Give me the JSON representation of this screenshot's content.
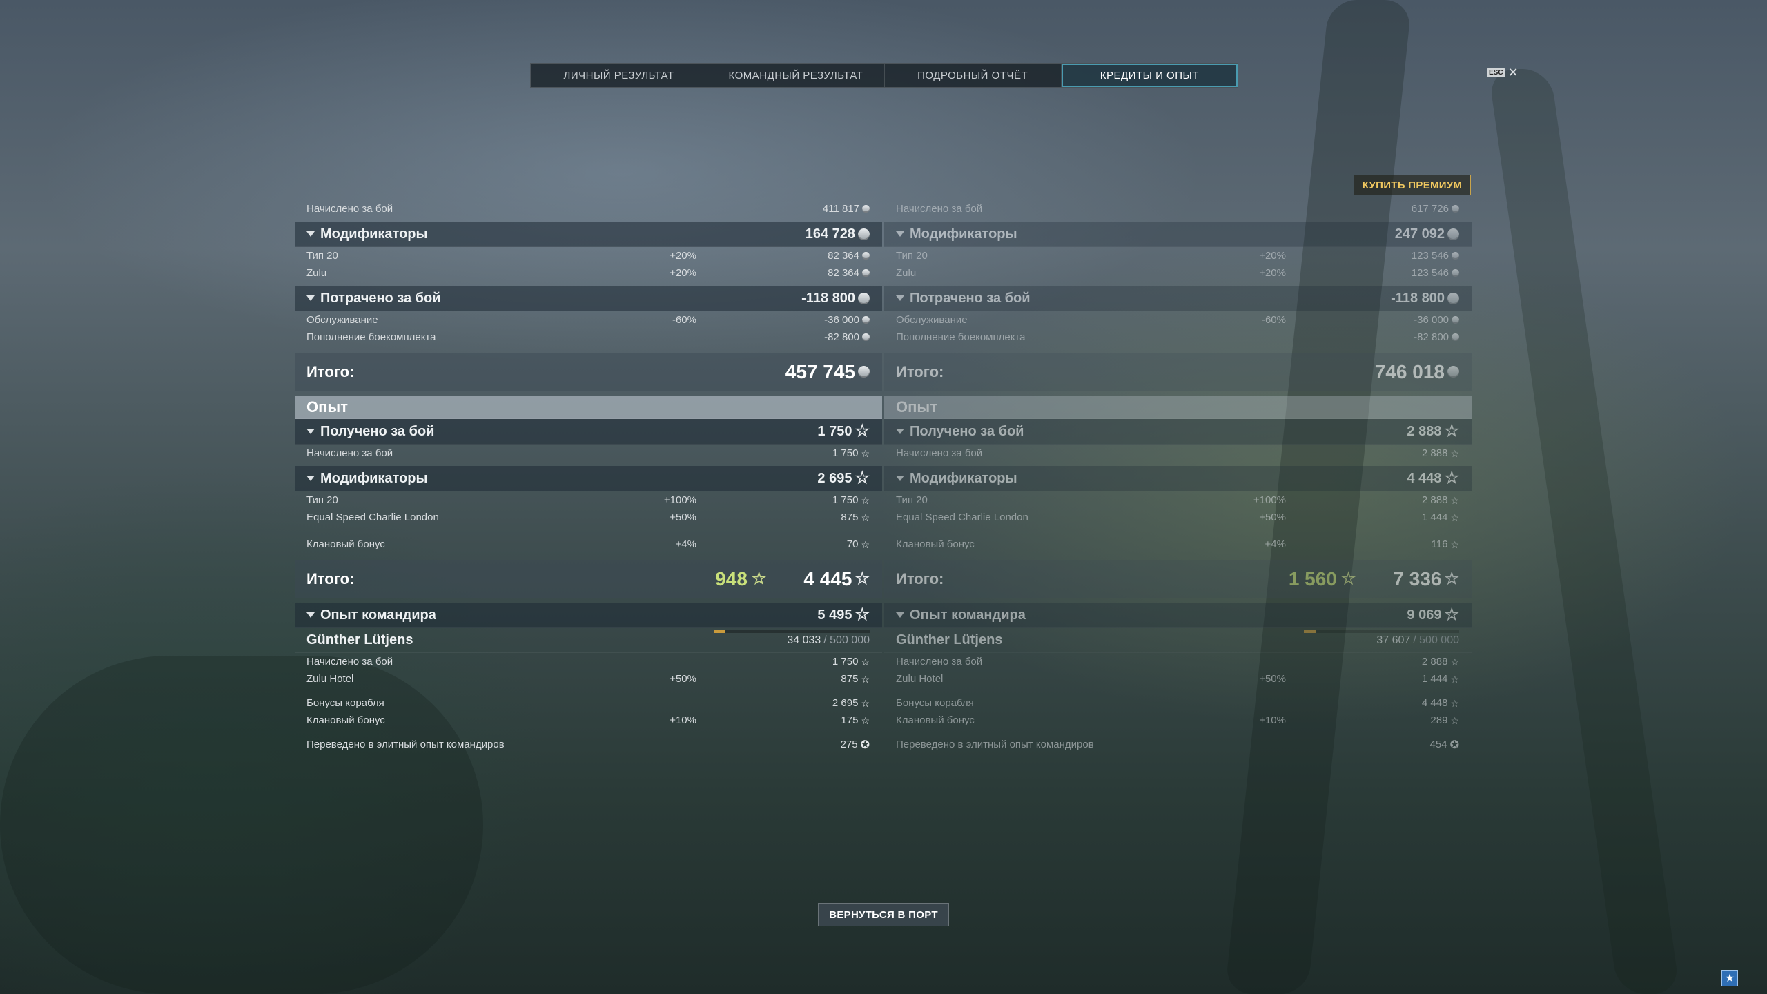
{
  "tabs": [
    {
      "label": "ЛИЧНЫЙ РЕЗУЛЬТАТ"
    },
    {
      "label": "КОМАНДНЫЙ РЕЗУЛЬТАТ"
    },
    {
      "label": "ПОДРОБНЫЙ ОТЧЁТ"
    },
    {
      "label": "КРЕДИТЫ И ОПЫТ",
      "active": true
    }
  ],
  "esc": {
    "key": "ESC",
    "close": "✕"
  },
  "premium_button": "КУПИТЬ ПРЕМИУМ",
  "back_button": "ВЕРНУТЬСЯ В ПОРТ",
  "corner_icon": "★",
  "panels": [
    {
      "credits": {
        "earned_label": "Начислено за бой",
        "earned": "411 817",
        "modifiers_label": "Модификаторы",
        "modifiers": "164 728",
        "mod_rows": [
          {
            "label": "Тип 20",
            "pct": "+20%",
            "val": "82 364"
          },
          {
            "label": "Zulu",
            "pct": "+20%",
            "val": "82 364"
          }
        ],
        "spent_label": "Потрачено за бой",
        "spent": "-118 800",
        "spent_rows": [
          {
            "label": "Обслуживание",
            "pct": "-60%",
            "val": "-36 000"
          },
          {
            "label": "Пополнение боекомплекта",
            "pct": "",
            "val": "-82 800"
          }
        ],
        "total_label": "Итого:",
        "total": "457 745"
      },
      "xp": {
        "section": "Опыт",
        "received_label": "Получено за бой",
        "received": "1 750",
        "earned_label": "Начислено за бой",
        "earned": "1 750",
        "modifiers_label": "Модификаторы",
        "modifiers": "2 695",
        "mod_rows": [
          {
            "label": "Тип 20",
            "pct": "+100%",
            "val": "1 750"
          },
          {
            "label": "Equal Speed Charlie London",
            "pct": "+50%",
            "val": "875"
          }
        ],
        "clan_label": "Клановый бонус",
        "clan_pct": "+4%",
        "clan": "70",
        "total_label": "Итого:",
        "free_xp": "948",
        "total": "4 445",
        "commander_label": "Опыт командира",
        "commander": "5 495",
        "commander_name": "Günther Lütjens",
        "commander_xp": "34 033",
        "commander_max": "/ 500 000",
        "commander_progress": 0.068,
        "cmd_rows": [
          {
            "label": "Начислено за бой",
            "pct": "",
            "val": "1 750"
          },
          {
            "label": "Zulu Hotel",
            "pct": "+50%",
            "val": "875"
          },
          {
            "label": "Бонусы корабля",
            "pct": "",
            "val": "2 695"
          },
          {
            "label": "Клановый бонус",
            "pct": "+10%",
            "val": "175"
          }
        ],
        "elite_label": "Переведено в элитный опыт командиров",
        "elite": "275"
      }
    },
    {
      "credits": {
        "earned_label": "Начислено за бой",
        "earned": "617 726",
        "modifiers_label": "Модификаторы",
        "modifiers": "247 092",
        "mod_rows": [
          {
            "label": "Тип 20",
            "pct": "+20%",
            "val": "123 546"
          },
          {
            "label": "Zulu",
            "pct": "+20%",
            "val": "123 546"
          }
        ],
        "spent_label": "Потрачено за бой",
        "spent": "-118 800",
        "spent_rows": [
          {
            "label": "Обслуживание",
            "pct": "-60%",
            "val": "-36 000"
          },
          {
            "label": "Пополнение боекомплекта",
            "pct": "",
            "val": "-82 800"
          }
        ],
        "total_label": "Итого:",
        "total": "746 018"
      },
      "xp": {
        "section": "Опыт",
        "received_label": "Получено за бой",
        "received": "2 888",
        "earned_label": "Начислено за бой",
        "earned": "2 888",
        "modifiers_label": "Модификаторы",
        "modifiers": "4 448",
        "mod_rows": [
          {
            "label": "Тип 20",
            "pct": "+100%",
            "val": "2 888"
          },
          {
            "label": "Equal Speed Charlie London",
            "pct": "+50%",
            "val": "1 444"
          }
        ],
        "clan_label": "Клановый бонус",
        "clan_pct": "+4%",
        "clan": "116",
        "total_label": "Итого:",
        "free_xp": "1 560",
        "total": "7 336",
        "commander_label": "Опыт командира",
        "commander": "9 069",
        "commander_name": "Günther Lütjens",
        "commander_xp": "37 607",
        "commander_max": "/ 500 000",
        "commander_progress": 0.075,
        "cmd_rows": [
          {
            "label": "Начислено за бой",
            "pct": "",
            "val": "2 888"
          },
          {
            "label": "Zulu Hotel",
            "pct": "+50%",
            "val": "1 444"
          },
          {
            "label": "Бонусы корабля",
            "pct": "",
            "val": "4 448"
          },
          {
            "label": "Клановый бонус",
            "pct": "+10%",
            "val": "289"
          }
        ],
        "elite_label": "Переведено в элитный опыт командиров",
        "elite": "454"
      }
    }
  ]
}
